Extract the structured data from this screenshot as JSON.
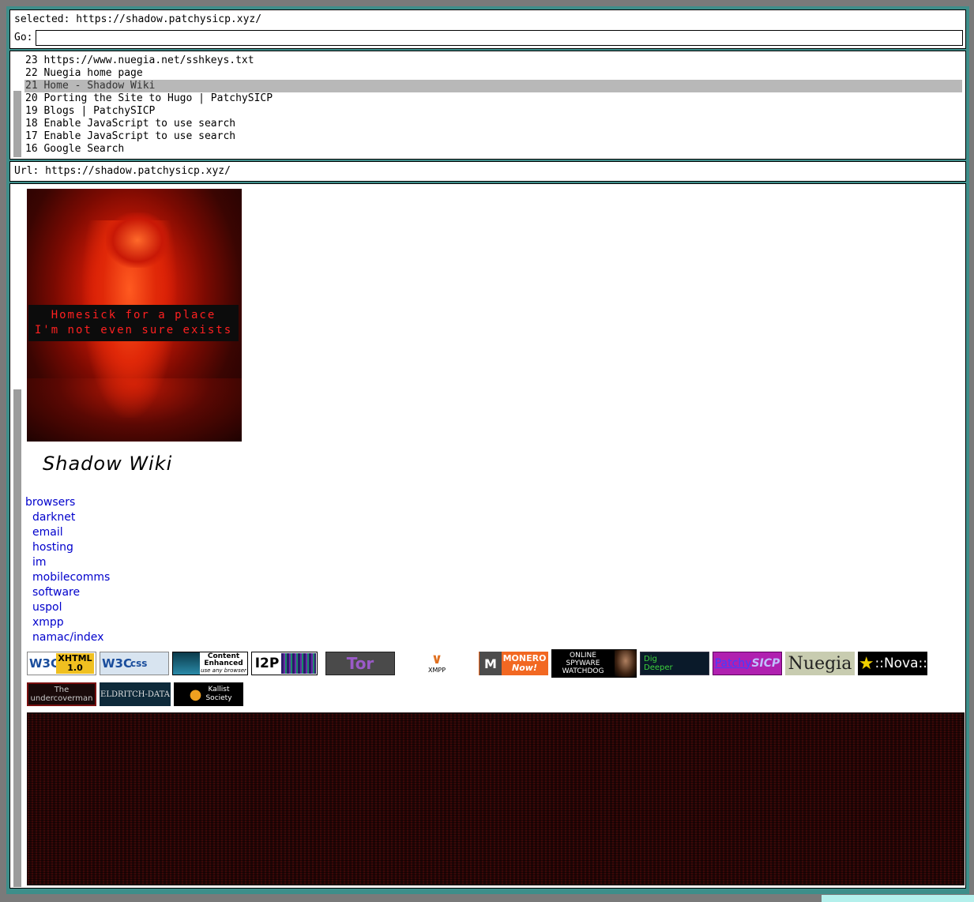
{
  "top": {
    "selected_label": "selected: https://shadow.patchysicp.xyz/",
    "go_label": "Go:",
    "go_value": ""
  },
  "history": [
    {
      "label": "23 https://www.nuegia.net/sshkeys.txt",
      "selected": false
    },
    {
      "label": "22 Nuegia home page",
      "selected": false
    },
    {
      "label": "21 Home - Shadow Wiki",
      "selected": true
    },
    {
      "label": "20 Porting the Site to Hugo | PatchySICP",
      "selected": false
    },
    {
      "label": "19 Blogs | PatchySICP",
      "selected": false
    },
    {
      "label": "18 Enable JavaScript to use search",
      "selected": false
    },
    {
      "label": "17 Enable JavaScript to use search",
      "selected": false
    },
    {
      "label": "16 Google Search",
      "selected": false
    }
  ],
  "url_line": "Url: https://shadow.patchysicp.xyz/",
  "banner": {
    "caption_line1": "Homesick for a place",
    "caption_line2": "I'm not even sure exists"
  },
  "site_title": "Shadow Wiki",
  "nav": [
    {
      "label": "browsers",
      "sub": false
    },
    {
      "label": "darknet",
      "sub": true
    },
    {
      "label": "email",
      "sub": true
    },
    {
      "label": "hosting",
      "sub": true
    },
    {
      "label": "im",
      "sub": true
    },
    {
      "label": "mobilecomms",
      "sub": true
    },
    {
      "label": "software",
      "sub": true
    },
    {
      "label": "uspol",
      "sub": true
    },
    {
      "label": "xmpp",
      "sub": true
    },
    {
      "label": "namac/index",
      "sub": true
    }
  ],
  "badges": {
    "w3c_xhtml": {
      "w3": "W3C",
      "text": "XHTML 1.0"
    },
    "w3c_css": {
      "w3": "W3C",
      "text": "css"
    },
    "content_enhanced": {
      "line1": "Content",
      "line2": "Enhanced",
      "line3": "use any browser"
    },
    "i2p": "I2P",
    "tor": "Tor",
    "xmpp": "XMPP",
    "monero": {
      "line1": "MONERO",
      "line2": "Now!"
    },
    "spyware": {
      "line1": "ONLINE",
      "line2": "SPYWARE",
      "line3": "WATCHDOG"
    },
    "dig": {
      "line1": "Dig",
      "line2": "Deeper"
    },
    "patchy": {
      "a": "Patchy",
      "b": "SICP"
    },
    "nuegia": "Nuegia",
    "nova": "::Nova::",
    "undercoverman": {
      "line1": "The",
      "line2": "undercoverman"
    },
    "eldritch": "ELDRITCH-DATA",
    "kallist": {
      "line1": "Kallist",
      "line2": "Society"
    }
  },
  "colors": {
    "frame": "#3e8e8a",
    "selected_row": "#b8b8b8",
    "link": "#0000cc"
  }
}
